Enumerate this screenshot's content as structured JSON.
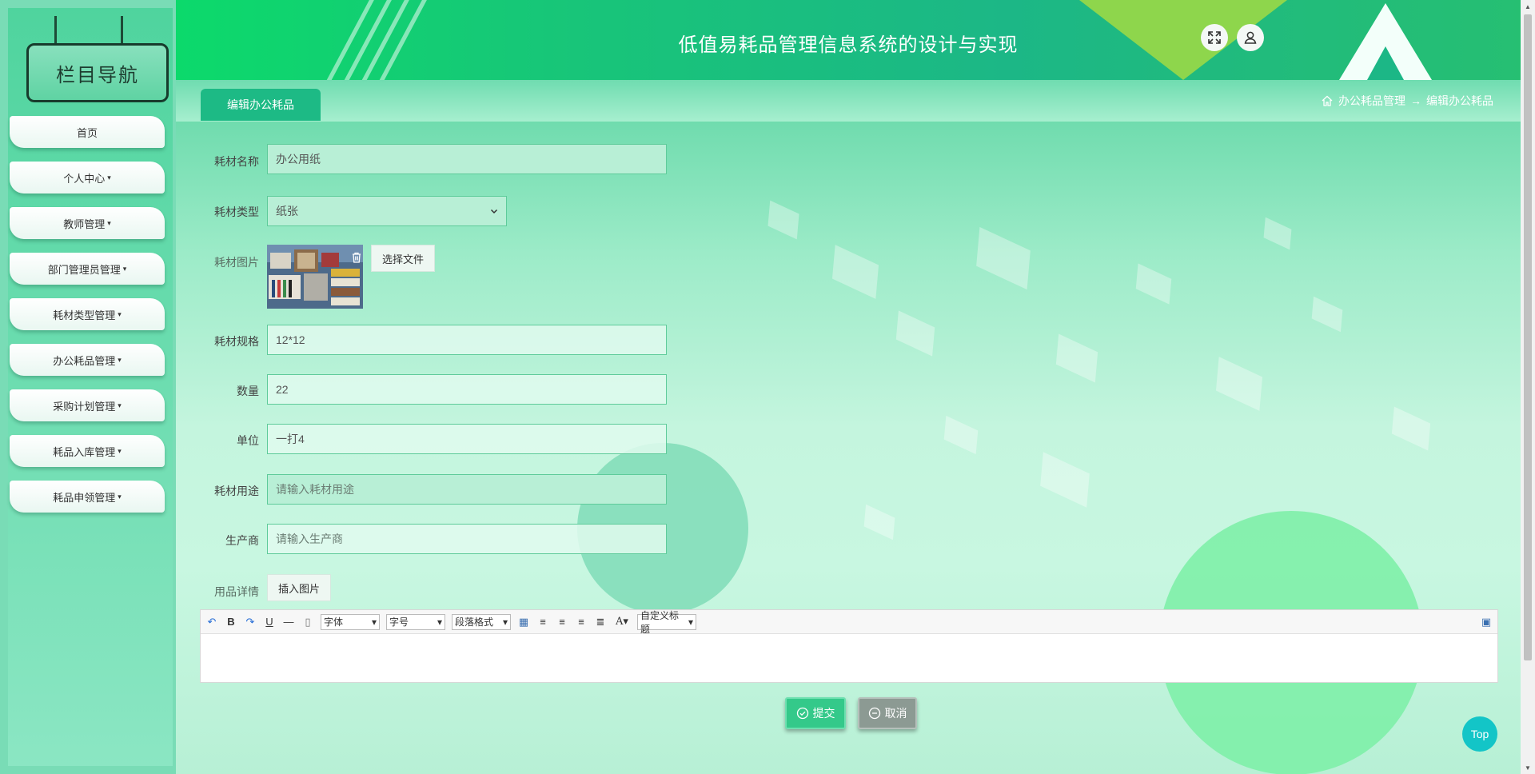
{
  "sidebar": {
    "title": "栏目导航",
    "items": [
      {
        "label": "首页",
        "caret": ""
      },
      {
        "label": "个人中心",
        "caret": "▾"
      },
      {
        "label": "教师管理",
        "caret": "▾"
      },
      {
        "label": "部门管理员管理",
        "caret": "▾"
      },
      {
        "label": "耗材类型管理",
        "caret": "▾"
      },
      {
        "label": "办公耗品管理",
        "caret": "▾"
      },
      {
        "label": "采购计划管理",
        "caret": "▾"
      },
      {
        "label": "耗品入库管理",
        "caret": "▾"
      },
      {
        "label": "耗品申领管理",
        "caret": "▾"
      }
    ]
  },
  "header": {
    "title": "低值易耗品管理信息系统的设计与实现",
    "fullscreen_icon": "expand-icon",
    "user_icon": "user-icon"
  },
  "tabbar": {
    "active_tab": "编辑办公耗品",
    "breadcrumb": {
      "home_icon": "home-icon",
      "parent": "办公耗品管理",
      "separator": "→",
      "current": "编辑办公耗品"
    }
  },
  "form": {
    "name": {
      "label": "耗材名称",
      "value": "办公用纸",
      "placeholder": ""
    },
    "type": {
      "label": "耗材类型",
      "value": "纸张"
    },
    "image": {
      "label": "耗材图片",
      "choose_label": "选择文件"
    },
    "spec": {
      "label": "耗材规格",
      "value": "12*12",
      "placeholder": ""
    },
    "quantity": {
      "label": "数量",
      "value": "22",
      "placeholder": ""
    },
    "unit": {
      "label": "单位",
      "value": "一打4",
      "placeholder": ""
    },
    "usage": {
      "label": "耗材用途",
      "value": "",
      "placeholder": "请输入耗材用途"
    },
    "maker": {
      "label": "生产商",
      "value": "",
      "placeholder": "请输入生产商"
    },
    "detail": {
      "label": "用品详情",
      "insert_image_label": "插入图片"
    }
  },
  "editor": {
    "font_label": "字体",
    "size_label": "字号",
    "paragraph_label": "段落格式",
    "custom_title_label": "自定义标题"
  },
  "actions": {
    "submit_label": "提交",
    "cancel_label": "取消",
    "top_label": "Top"
  },
  "colors": {
    "accent": "#1dba85",
    "header_green": "#0fd66b",
    "top_button": "#13c5c7"
  }
}
